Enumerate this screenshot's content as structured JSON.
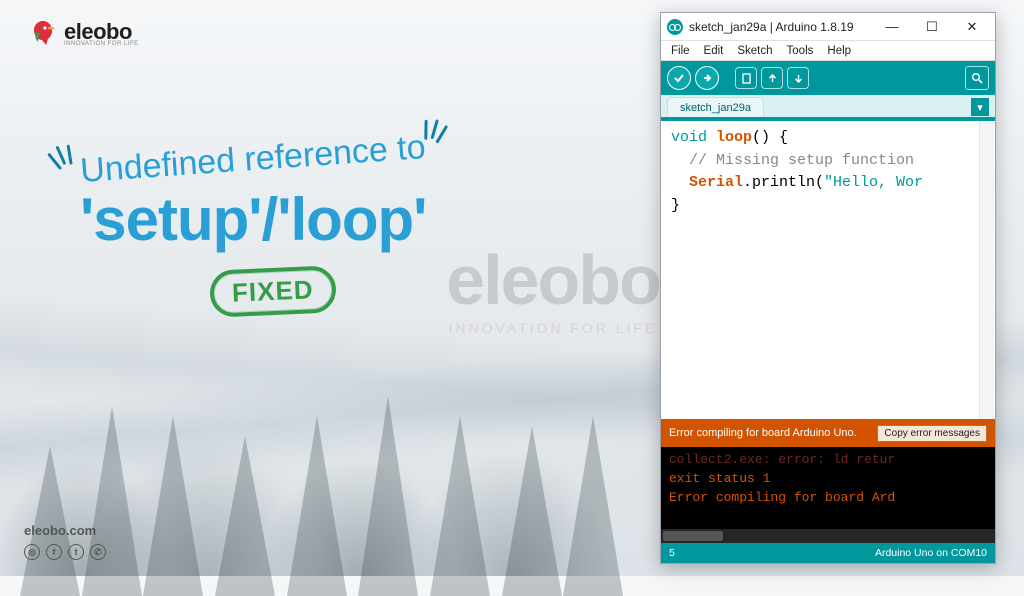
{
  "brand": {
    "name": "eleobo",
    "tagline": "INNOVATION FOR LIFE",
    "website": "eleobo.com"
  },
  "headline": {
    "line1": "Undefined reference to",
    "line2": "'setup'/'loop'",
    "stamp": "FIXED"
  },
  "watermark": {
    "logo": "eleobo",
    "sub": "INNOVATION FOR LIFE"
  },
  "social": [
    "instagram",
    "facebook",
    "twitter",
    "whatsapp"
  ],
  "arduino": {
    "window_title": "sketch_jan29a | Arduino 1.8.19",
    "menus": [
      "File",
      "Edit",
      "Sketch",
      "Tools",
      "Help"
    ],
    "toolbar_icons": [
      "verify",
      "upload",
      "new",
      "open",
      "save"
    ],
    "serial_icon": "serial-monitor",
    "tab_name": "sketch_jan29a",
    "code": {
      "line1_kw": "void",
      "line1_fn": "loop",
      "line1_rest": "() {",
      "line2_comment": "// Missing setup function",
      "line3_obj": "Serial",
      "line3_method": ".println(",
      "line3_str": "\"Hello, Wor",
      "line4": "}"
    },
    "error_bar": "Error compiling for board Arduino Uno.",
    "copy_button": "Copy error messages",
    "console_lines": [
      "exit status 1",
      "Error compiling for board Ard"
    ],
    "status_left": "5",
    "status_right": "Arduino Uno on COM10"
  }
}
